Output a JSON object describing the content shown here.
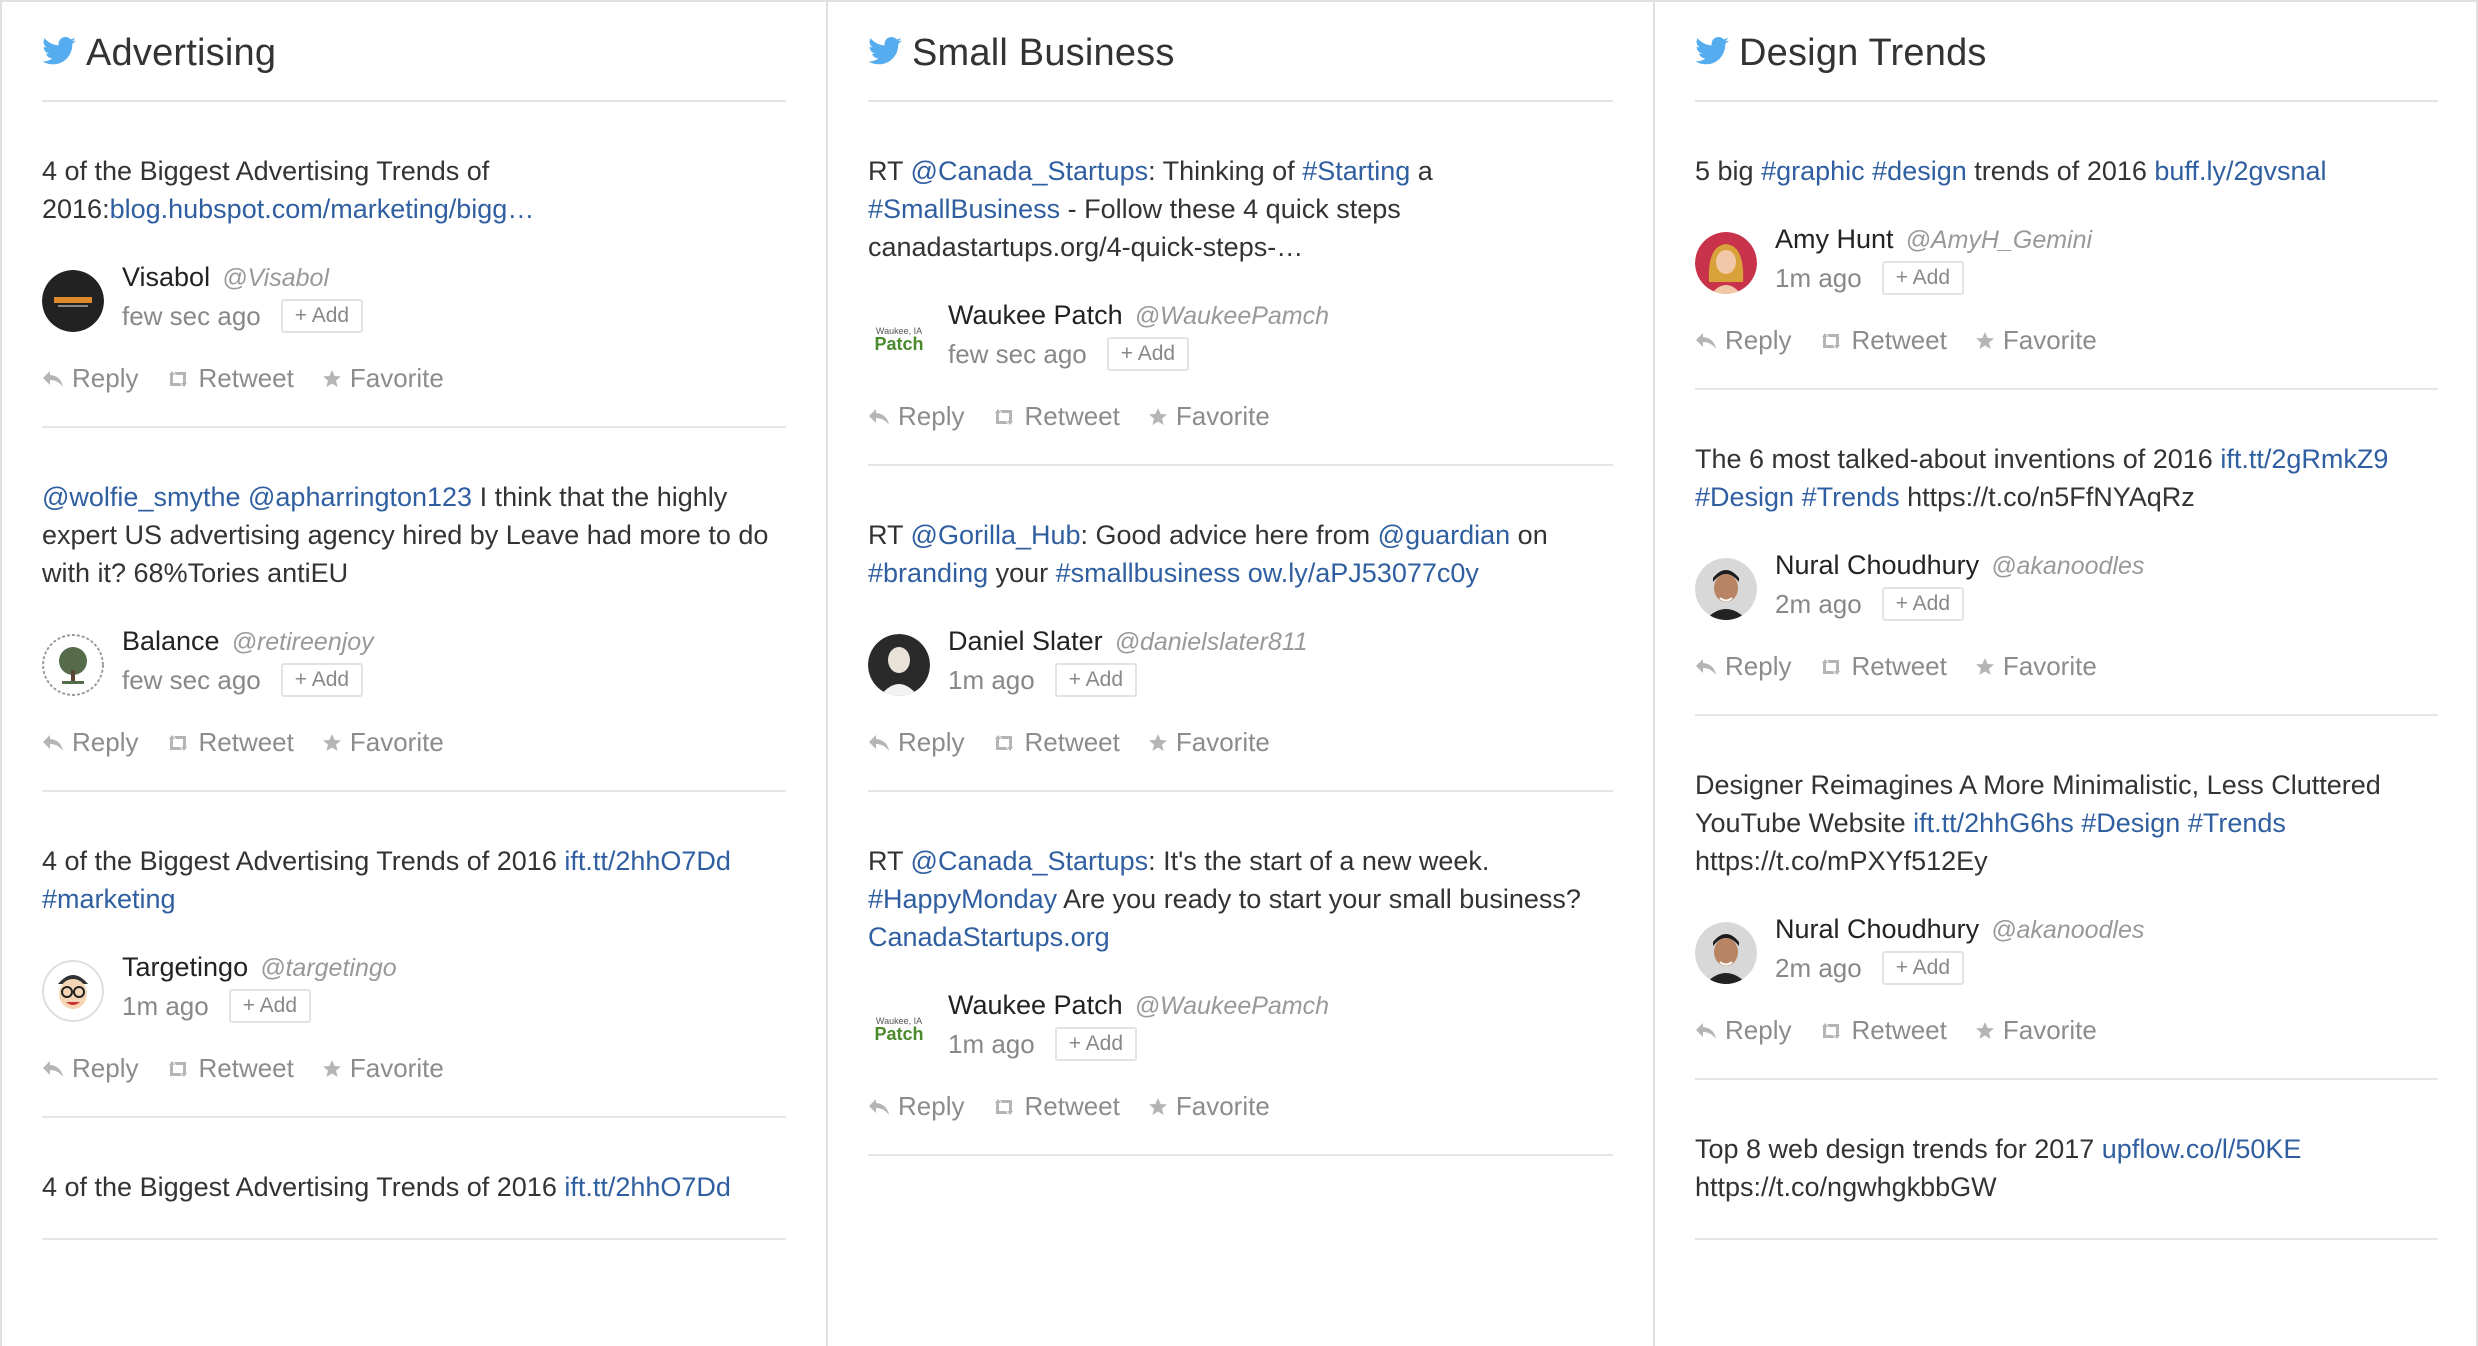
{
  "columns": [
    {
      "title": "Advertising",
      "tweets": [
        {
          "segments": [
            {
              "text": "4 of the Biggest Advertising Trends of 2016:",
              "link": false
            },
            {
              "text": "blog.hubspot.com/marketing/bigg…",
              "link": true
            }
          ],
          "author": "Visabol",
          "handle": "@Visabol",
          "time": "few sec ago",
          "avatar": "visabol-logo"
        },
        {
          "segments": [
            {
              "text": "@wolfie_smythe",
              "link": true
            },
            {
              "text": " ",
              "link": false
            },
            {
              "text": "@apharrington123",
              "link": true
            },
            {
              "text": " I think that the highly expert US advertising agency hired by Leave had more to do with it? 68%Tories antiEU",
              "link": false
            }
          ],
          "author": "Balance",
          "handle": "@retireenjoy",
          "time": "few sec ago",
          "avatar": "tree-seal"
        },
        {
          "segments": [
            {
              "text": "4 of the Biggest Advertising Trends of 2016 ",
              "link": false
            },
            {
              "text": "ift.tt/2hhO7Dd",
              "link": true
            },
            {
              "text": " ",
              "link": false
            },
            {
              "text": "#marketing",
              "link": true
            }
          ],
          "author": "Targetingo",
          "handle": "@targetingo",
          "time": "1m ago",
          "avatar": "cartoon-face"
        },
        {
          "segments": [
            {
              "text": "4 of the Biggest Advertising Trends of 2016 ",
              "link": false
            },
            {
              "text": "ift.tt/2hhO7Dd",
              "link": true
            }
          ],
          "author": "",
          "handle": "",
          "time": "",
          "avatar": ""
        }
      ]
    },
    {
      "title": "Small Business",
      "tweets": [
        {
          "segments": [
            {
              "text": "RT ",
              "link": false
            },
            {
              "text": "@Canada_Startups",
              "link": true
            },
            {
              "text": ": Thinking of ",
              "link": false
            },
            {
              "text": "#Starting",
              "link": true
            },
            {
              "text": " a ",
              "link": false
            },
            {
              "text": "#SmallBusiness",
              "link": true
            },
            {
              "text": " - Follow these 4 quick steps canadastartups.org/4-quick-steps-…",
              "link": false
            }
          ],
          "author": "Waukee Patch",
          "handle": "@WaukeePamch",
          "time": "few sec ago",
          "avatar": "patch-logo"
        },
        {
          "segments": [
            {
              "text": "RT ",
              "link": false
            },
            {
              "text": "@Gorilla_Hub",
              "link": true
            },
            {
              "text": ": Good advice here from ",
              "link": false
            },
            {
              "text": "@guardian",
              "link": true
            },
            {
              "text": " on ",
              "link": false
            },
            {
              "text": "#branding",
              "link": true
            },
            {
              "text": " your ",
              "link": false
            },
            {
              "text": "#smallbusiness",
              "link": true
            },
            {
              "text": " ",
              "link": false
            },
            {
              "text": "ow.ly/aPJ53077c0y",
              "link": true
            }
          ],
          "author": "Daniel Slater",
          "handle": "@danielslater811",
          "time": "1m ago",
          "avatar": "person-photo"
        },
        {
          "segments": [
            {
              "text": "RT ",
              "link": false
            },
            {
              "text": "@Canada_Startups",
              "link": true
            },
            {
              "text": ": It's the start of a new week. ",
              "link": false
            },
            {
              "text": "#HappyMonday",
              "link": true
            },
            {
              "text": " Are you ready to start your small business? ",
              "link": false
            },
            {
              "text": "CanadaStartups.org",
              "link": true
            }
          ],
          "author": "Waukee Patch",
          "handle": "@WaukeePamch",
          "time": "1m ago",
          "avatar": "patch-logo"
        }
      ]
    },
    {
      "title": "Design Trends",
      "tweets": [
        {
          "segments": [
            {
              "text": "5 big ",
              "link": false
            },
            {
              "text": "#graphic",
              "link": true
            },
            {
              "text": " ",
              "link": false
            },
            {
              "text": "#design",
              "link": true
            },
            {
              "text": " trends of 2016 ",
              "link": false
            },
            {
              "text": "buff.ly/2gvsnal",
              "link": true
            }
          ],
          "author": "Amy Hunt",
          "handle": "@AmyH_Gemini",
          "time": "1m ago",
          "avatar": "person-photo-red"
        },
        {
          "segments": [
            {
              "text": "The 6 most talked-about inventions of 2016 ",
              "link": false
            },
            {
              "text": "ift.tt/2gRmkZ9",
              "link": true
            },
            {
              "text": " ",
              "link": false
            },
            {
              "text": "#Design",
              "link": true
            },
            {
              "text": " ",
              "link": false
            },
            {
              "text": "#Trends",
              "link": true
            },
            {
              "text": " https://t.co/n5FfNYAqRz",
              "link": false
            }
          ],
          "author": "Nural Choudhury",
          "handle": "@akanoodles",
          "time": "2m ago",
          "avatar": "person-photo-man"
        },
        {
          "segments": [
            {
              "text": "Designer Reimagines A More Minimalistic, Less Cluttered YouTube Website ",
              "link": false
            },
            {
              "text": "ift.tt/2hhG6hs",
              "link": true
            },
            {
              "text": " ",
              "link": false
            },
            {
              "text": "#Design",
              "link": true
            },
            {
              "text": " ",
              "link": false
            },
            {
              "text": "#Trends",
              "link": true
            },
            {
              "text": " https://t.co/mPXYf512Ey",
              "link": false
            }
          ],
          "author": "Nural Choudhury",
          "handle": "@akanoodles",
          "time": "2m ago",
          "avatar": "person-photo-man"
        },
        {
          "segments": [
            {
              "text": "Top 8 web design trends for 2017 ",
              "link": false
            },
            {
              "text": "upflow.co/l/50KE",
              "link": true
            },
            {
              "text": " https://t.co/ngwhgkbbGW",
              "link": false
            }
          ],
          "author": "",
          "handle": "",
          "time": "",
          "avatar": ""
        }
      ]
    }
  ],
  "labels": {
    "add": "+ Add",
    "reply": "Reply",
    "retweet": "Retweet",
    "favorite": "Favorite"
  },
  "colors": {
    "link": "#2f5fa0",
    "twitter_blue": "#55acee",
    "muted": "#8c8c8c"
  },
  "icons": [
    "twitter-bird-icon",
    "reply-icon",
    "retweet-icon",
    "star-icon"
  ]
}
